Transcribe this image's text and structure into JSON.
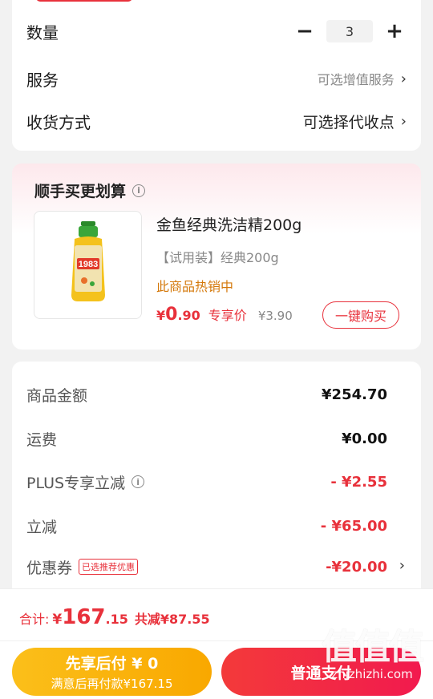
{
  "colors": {
    "accent": "#e8313b",
    "hot": "#d4780a",
    "later_btn": "#fbbf1a",
    "pay_btn": "#f2264a"
  },
  "order": {
    "quantity_label": "数量",
    "quantity_value": "3",
    "minus_icon": "minus-icon",
    "plus_icon": "plus-icon",
    "service_label": "服务",
    "service_value": "可选增值服务",
    "shipping_label": "收货方式",
    "shipping_value": "可选择代收点",
    "chevron": "›"
  },
  "upsell": {
    "title": "顺手买更划算",
    "info": "i",
    "product": {
      "name": "金鱼经典洗洁精200g",
      "spec": "【试用装】经典200g",
      "hot": "此商品热销中",
      "price_symbol": "¥",
      "price_int": "0",
      "price_dec": ".90",
      "price_tag": "专享价",
      "original_price": "¥3.90",
      "buy_label": "一键购买",
      "image_text": "1983"
    }
  },
  "summary": {
    "goods_label": "商品金额",
    "goods_value": "¥254.70",
    "freight_label": "运费",
    "freight_value": "¥0.00",
    "plus_label": "PLUS专享立减",
    "plus_value": "- ¥2.55",
    "discount_label": "立减",
    "discount_value": "- ¥65.00",
    "coupon_label": "优惠券",
    "coupon_badge": "已选推荐优惠",
    "coupon_value": "-¥20.00",
    "chevron": "›"
  },
  "footer": {
    "total_label": "合计:",
    "total_symbol": "¥",
    "total_int": "167",
    "total_dec": ".15",
    "total_saved": "共减¥87.55",
    "later_main": "先享后付 ¥ 0",
    "later_sub": "满意后再付款¥167.15",
    "pay_label": "普通支付"
  },
  "watermark": {
    "logo": "值值值",
    "url": "zhizhizhi.com"
  }
}
